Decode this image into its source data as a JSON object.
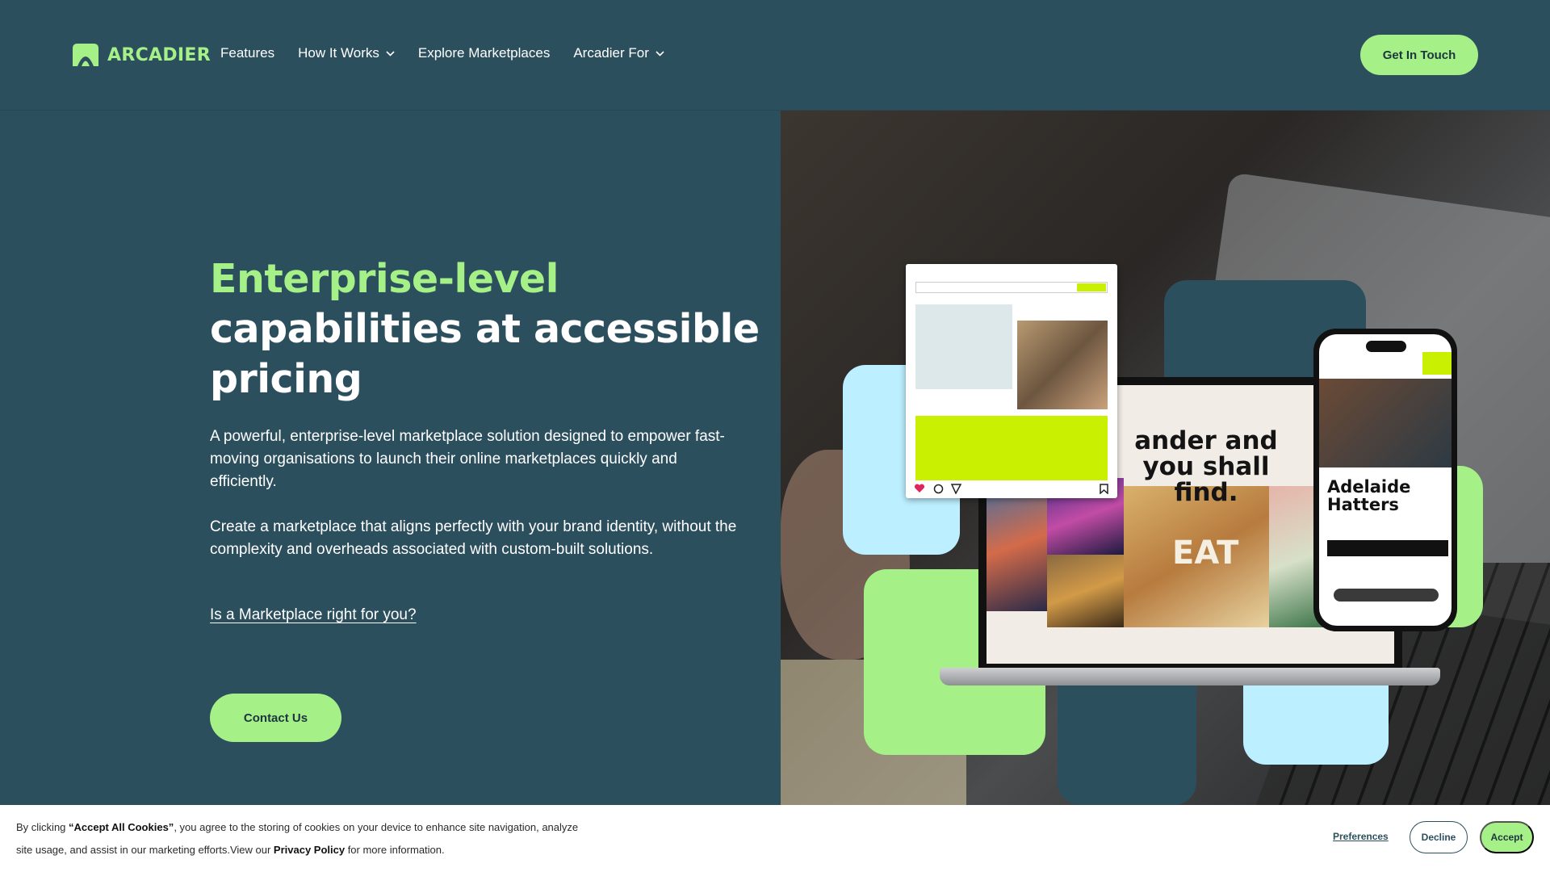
{
  "nav": {
    "logo_text": "ARCADIER",
    "links": [
      {
        "label": "Features"
      },
      {
        "label": "How It Works"
      },
      {
        "label": "Explore Marketplaces"
      },
      {
        "label": "Arcadier For"
      }
    ],
    "cta_label": "Get In Touch"
  },
  "hero": {
    "title_accent": "Enterprise-level",
    "title_rest": " capabilities at accessible pricing",
    "paragraph_1": "A powerful, enterprise-level marketplace solution designed to empower fast-moving organisations to launch their online marketplaces quickly and efficiently.",
    "paragraph_2": "Create a marketplace that aligns perfectly with your brand identity, without the complexity and overheads associated with custom-built solutions.",
    "link_text": "Is a Marketplace right for you?",
    "contact_label": "Contact Us",
    "image": {
      "laptop_headline": "ander and you shall find.",
      "laptop_tile_text": "EAT",
      "phone_title": "Adelaide Hatters"
    }
  },
  "cookie": {
    "prefix": "By clicking ",
    "accept_all": "“Accept All Cookies”",
    "middle": ", you agree to the storing of cookies on your device to enhance site navigation, analyze site usage, and assist in our marketing efforts.View our ",
    "privacy_policy": "Privacy Policy",
    "suffix": " for more information.",
    "preferences_label": "Preferences",
    "decline_label": "Decline",
    "accept_label": "Accept"
  },
  "colors": {
    "background": "#2c4f5e",
    "accent": "#a6f088",
    "light_blue": "#bcefff"
  },
  "icons": [
    "arcadier-logo-icon",
    "chevron-down-icon"
  ]
}
